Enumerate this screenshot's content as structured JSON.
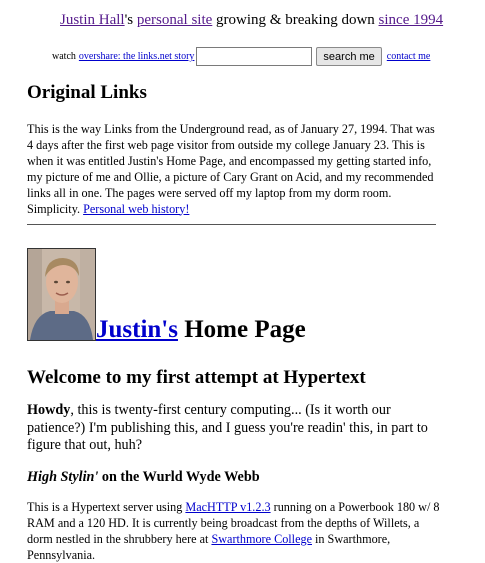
{
  "header": {
    "name_link": "Justin Hall",
    "possessive": "'s ",
    "site_link": "personal site",
    "growing_text": " growing & breaking down ",
    "since_link": "since 1994"
  },
  "search": {
    "watch_label": "watch ",
    "overshare_link": "overshare: the links.net story",
    "input_value": "",
    "button_label": "search me",
    "contact_link": "contact me"
  },
  "original": {
    "heading": "Original Links",
    "paragraph": "This is the way Links from the Underground read, as of January 27, 1994. That was 4 days after the first web page visitor from outside my college January 23. This is when it was entitled Justin's Home Page, and encompassed my getting started info, my picture of me and Ollie, a picture of Cary Grant on Acid, and my recommended links all in one. The pages were served off my laptop from my dorm room. Simplicity. ",
    "history_link": "Personal web history!"
  },
  "homepage": {
    "title_link": "Justin's",
    "title_rest": " Home Page",
    "welcome": "Welcome to my first attempt at Hypertext",
    "howdy_bold": "Howdy",
    "howdy_text": ", this is twenty-first century computing... (Is it worth our patience?) I'm publishing this, and I guess you're readin' this, in part to figure that out, huh?",
    "stylin_italic": "High Stylin'",
    "stylin_rest": " on the Wurld Wyde Webb",
    "server_text_1": "This is a Hypertext server using ",
    "machttp_link": "MacHTTP v1.2.3",
    "server_text_2": " running on a Powerbook 180 w/ 8 RAM and a 120 HD. It is currently being broadcast from the depths of Willets, a dorm nestled in the shrubbery here at ",
    "swarthmore_link": "Swarthmore College",
    "server_text_3": " in Swarthmore, Pennsylvania."
  },
  "colors": {
    "link": "#0000cc",
    "visited_link": "#551a8b",
    "background": "#ffffff",
    "text": "#000000"
  }
}
